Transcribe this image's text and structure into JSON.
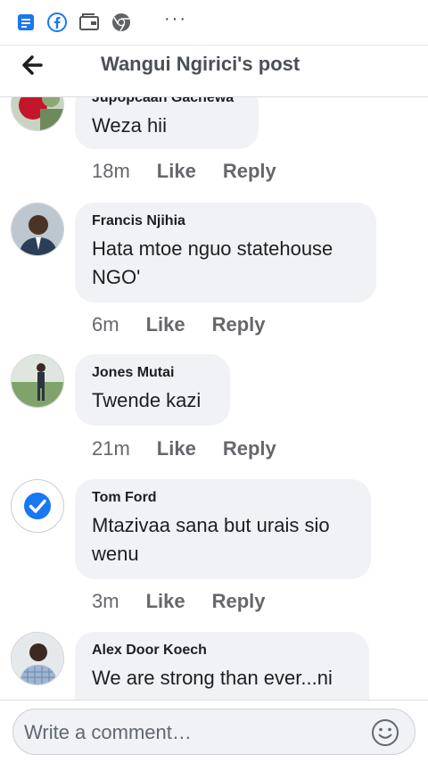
{
  "header": {
    "title": "Wangui Ngirici's post",
    "back_icon": "arrow-left-icon"
  },
  "statusbar": {
    "icons": [
      "messages-icon",
      "facebook-icon",
      "wallet-icon",
      "chrome-icon"
    ],
    "more": "···"
  },
  "comments": [
    {
      "name": "Jupopcaan Gachewa",
      "text": "Weza hii",
      "time": "18m",
      "like": "Like",
      "reply": "Reply"
    },
    {
      "name": "Francis Njihia",
      "text": "Hata mtoe nguo statehouse NGO'",
      "time": "6m",
      "like": "Like",
      "reply": "Reply"
    },
    {
      "name": "Jones Mutai",
      "text": "Twende kazi",
      "time": "21m",
      "like": "Like",
      "reply": "Reply"
    },
    {
      "name": "Tom Ford",
      "text": "Mtazivaa sana but urais sio wenu",
      "time": "3m",
      "like": "Like",
      "reply": "Reply"
    },
    {
      "name": "Alex Door Koech",
      "text": "We are strong than ever...ni",
      "time": "",
      "like": "",
      "reply": ""
    }
  ],
  "composer": {
    "placeholder": "Write a comment…",
    "emoji_icon": "smiley-icon"
  },
  "colors": {
    "facebook_blue": "#1877f2",
    "bubble_bg": "#f0f2f5",
    "meta_text": "#65676b"
  }
}
